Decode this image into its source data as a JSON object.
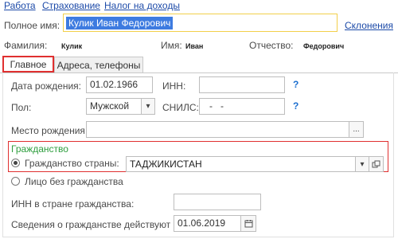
{
  "top_links": [
    "Работа",
    "Страхование",
    "Налог на доходы"
  ],
  "full_name": {
    "label": "Полное имя:",
    "value": "Кулик Иван Федорович",
    "declensions_link": "Склонения"
  },
  "name_parts": {
    "surname_label": "Фамилия:",
    "surname": "Кулик",
    "first_label": "Имя:",
    "first": "Иван",
    "patronymic_label": "Отчество:",
    "patronymic": "Федорович"
  },
  "tabs": [
    {
      "label": "Главное",
      "active": true
    },
    {
      "label": "Адреса, телефоны",
      "active": false
    }
  ],
  "main": {
    "birth_date_label": "Дата рождения:",
    "birth_date": "01.02.1966",
    "inn_label": "ИНН:",
    "inn": "",
    "help": "?",
    "sex_label": "Пол:",
    "sex": "Мужской",
    "snils_label": "СНИЛС:",
    "snils": "-   -",
    "birthplace_label": "Место рождения:",
    "birthplace": "",
    "ellipsis": "...",
    "citizenship_title": "Гражданство",
    "citizen_radio_label": "Гражданство страны:",
    "citizen_country": "ТАДЖИКИСТАН",
    "stateless_radio_label": "Лицо без гражданства",
    "foreign_inn_label": "ИНН в стране гражданства:",
    "foreign_inn": "",
    "valid_from_label": "Сведения о гражданстве действуют с:",
    "valid_from": "01.06.2019"
  },
  "colors": {
    "link": "#1c4aa8",
    "accent_red": "#e03030",
    "citizenship_green": "#2e9e3e",
    "highlight": "#3d7be0",
    "focus_yellow": "#f2cf4a"
  }
}
